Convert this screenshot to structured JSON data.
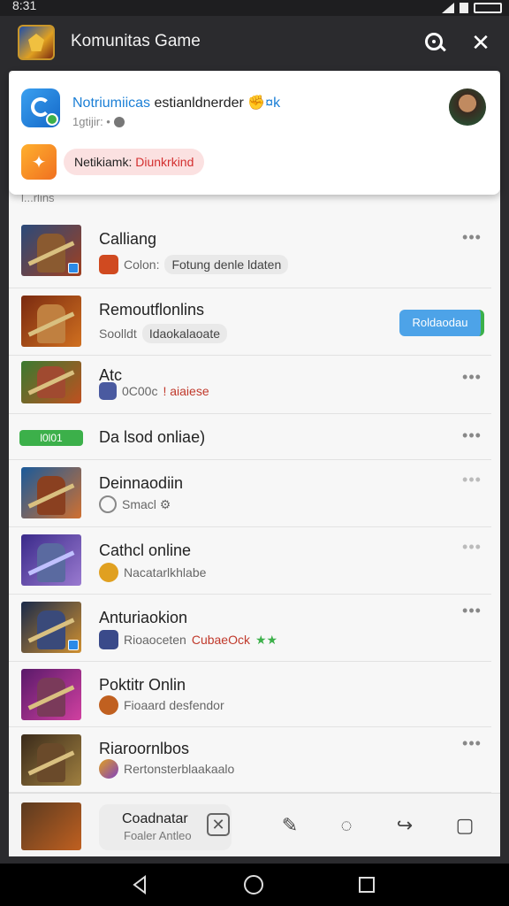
{
  "status_bar": {
    "time": "8:31"
  },
  "app_bar": {
    "title": "Komunitas Game",
    "search_icon": "search-icon",
    "close_icon": "close-icon"
  },
  "notification": {
    "title_highlight": "Notriumiicas",
    "title_rest": " estianldnerder",
    "title_tail": "✊¤k",
    "subtitle": "1gtijir: •",
    "pill_prefix": "Netikiamk: ",
    "pill_red": "Diunkrkind"
  },
  "section_label": "l...rlins",
  "rows": [
    {
      "title": "Calliang",
      "sub_label": "Colon:",
      "chip": "Fotung denle ldaten",
      "action": "•••"
    },
    {
      "title": "Remoutflonlins",
      "sub_label": "Soolldt",
      "chip": "Idaokalaoate",
      "button": "Roldaodau"
    },
    {
      "title": "Atc",
      "sub_label": "0C00c",
      "sub_red": "! aiaiese",
      "action": "•••"
    },
    {
      "title": "Da lsod onliae)",
      "tag": "l0l01",
      "action": "•••"
    },
    {
      "title": "Deinnaodiin",
      "sub_label": "Smacl ⚙",
      "action": "•••"
    },
    {
      "title": "Cathcl online",
      "sub_label": "Nacatarlkhlabe",
      "action": "•••"
    },
    {
      "title": "Anturiaokion",
      "sub_label": "Rioaoceten",
      "sub_red": "CubaeOck",
      "sub_green": "★★",
      "action": "•••"
    },
    {
      "title": "Poktitr Onlin",
      "sub_label": "Fioaard desfendor"
    },
    {
      "title": "Riaroornlbos",
      "sub_label": "Rertonsterblaakaalo",
      "action": "•••"
    }
  ],
  "bottom_strip": {
    "title": "Coadnatar",
    "subtitle": "Foaler Antleo",
    "prefix": "I̶"
  },
  "colors": {
    "accent_blue": "#4da3e8",
    "green": "#3cb04a",
    "red": "#d32f2f"
  }
}
